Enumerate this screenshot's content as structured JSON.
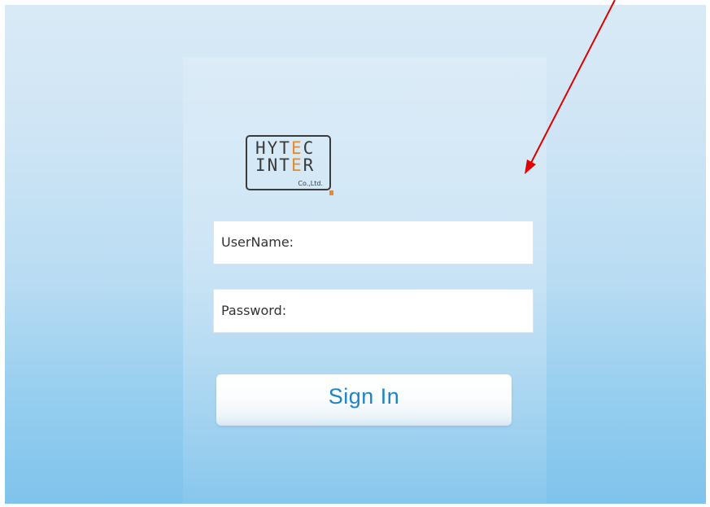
{
  "logo": {
    "line1_plain": "HYT",
    "line1_accent": "E",
    "line1_end": "C",
    "line2_plain": "INT",
    "line2_accent": "E",
    "line2_end": "R",
    "company_suffix": "Co.,Ltd."
  },
  "form": {
    "username_label": "UserName:",
    "username_value": "",
    "password_label": "Password:",
    "password_value": "",
    "signin_label": "Sign In"
  },
  "colors": {
    "logo_accent": "#e88a2c",
    "signin_text": "#1f83c6",
    "annotation_arrow": "#e00000"
  },
  "annotation": {
    "type": "arrow",
    "icon": "red-arrow-icon"
  }
}
